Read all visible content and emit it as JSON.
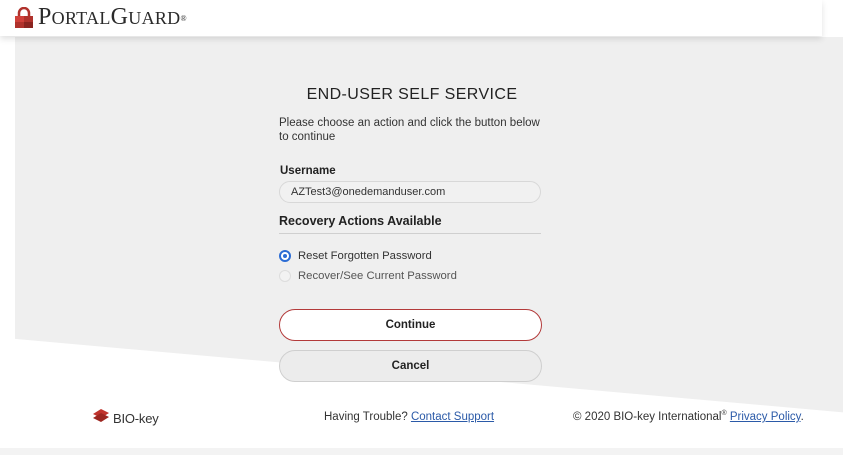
{
  "header": {
    "logo_text_first": "P",
    "logo_text_rest1": "ORTAL",
    "logo_text_second": "G",
    "logo_text_rest2": "UARD",
    "logo_reg": "®"
  },
  "panel": {
    "title": "END-USER SELF SERVICE",
    "instructions": "Please choose an action and click the button below to continue",
    "username_label": "Username",
    "username_value": "AZTest3@onedemanduser.com",
    "recovery_heading": "Recovery Actions Available",
    "options": [
      {
        "label": "Reset Forgotten Password",
        "checked": true,
        "enabled": true
      },
      {
        "label": "Recover/See Current Password",
        "checked": false,
        "enabled": false
      }
    ],
    "continue_label": "Continue",
    "cancel_label": "Cancel"
  },
  "footer": {
    "biokey_text": "BIO-key",
    "trouble_text": "Having Trouble?",
    "contact_link": "Contact Support",
    "copyright_text": "© 2020 BIO-key International",
    "copyright_reg": "®",
    "privacy_link": "Privacy Policy",
    "period": "."
  },
  "colors": {
    "accent_red": "#b33a3a",
    "radio_blue": "#2b6cd4",
    "link_blue": "#2b5aa8",
    "band_gray": "#efefef"
  },
  "icons": {
    "header_logo": "padlock-icon",
    "footer_logo": "biokey-logo-icon"
  }
}
